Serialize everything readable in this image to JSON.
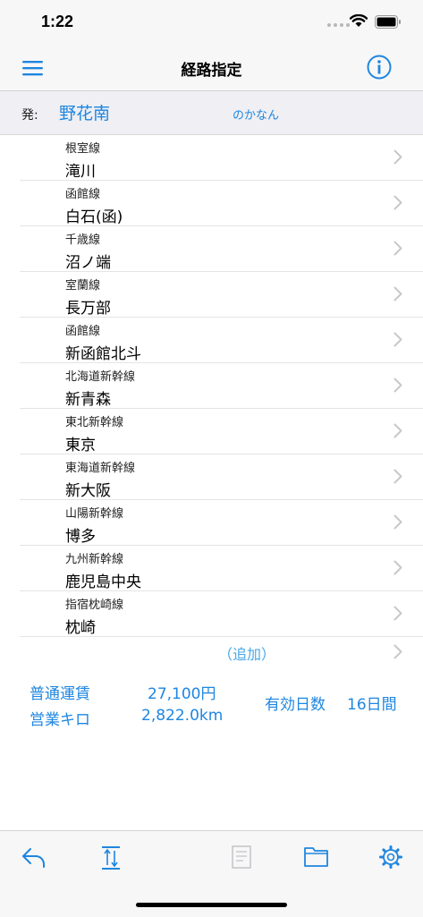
{
  "status_bar": {
    "time": "1:22"
  },
  "navbar": {
    "title": "経路指定"
  },
  "departure": {
    "label": "発:",
    "station": "野花南",
    "reading": "のかなん"
  },
  "route": [
    {
      "line": "根室線",
      "station": "滝川"
    },
    {
      "line": "函館線",
      "station": "白石(函)"
    },
    {
      "line": "千歳線",
      "station": "沼ノ端"
    },
    {
      "line": "室蘭線",
      "station": "長万部"
    },
    {
      "line": "函館線",
      "station": "新函館北斗"
    },
    {
      "line": "北海道新幹線",
      "station": "新青森"
    },
    {
      "line": "東北新幹線",
      "station": "東京"
    },
    {
      "line": "東海道新幹線",
      "station": "新大阪"
    },
    {
      "line": "山陽新幹線",
      "station": "博多"
    },
    {
      "line": "九州新幹線",
      "station": "鹿児島中央"
    },
    {
      "line": "指宿枕崎線",
      "station": "枕崎"
    }
  ],
  "add_label": "（追加）",
  "summary": {
    "fare_label": "普通運賃",
    "fare_value": "27,100円",
    "km_label": "営業キロ",
    "km_value": "2,822.0km",
    "valid_label": "有効日数",
    "valid_value": "16日間"
  },
  "colors": {
    "accent": "#1e86e0",
    "chevron": "#c7c7cc",
    "disabled": "#c7c7cc"
  },
  "icons": {
    "menu": "hamburger-menu-icon",
    "info": "info-circle-icon",
    "undo": "undo-arrow-icon",
    "reverse": "reverse-route-icon",
    "memo": "memo-icon",
    "folder": "folder-icon",
    "settings": "gear-icon"
  }
}
